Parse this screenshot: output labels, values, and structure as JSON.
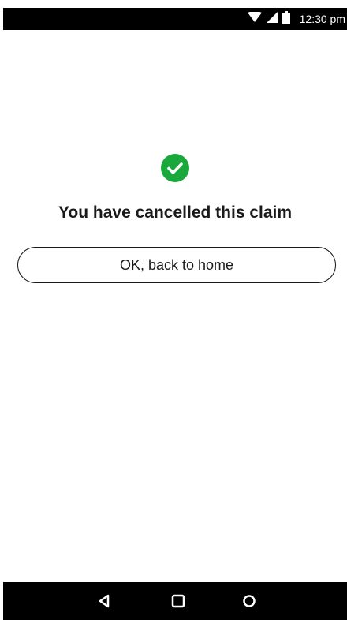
{
  "status_bar": {
    "time": "12:30 pm",
    "icons": [
      "wifi-icon",
      "signal-icon",
      "battery-icon"
    ]
  },
  "main": {
    "success_icon": "check-circle-icon",
    "title": "You have cancelled this claim",
    "button_label": "OK, back to home"
  },
  "nav_bar": {
    "buttons": [
      "back-icon",
      "home-icon",
      "recents-icon"
    ]
  },
  "colors": {
    "success": "#1aa83c",
    "text": "#1a1a1a",
    "system_bars": "#000000"
  }
}
